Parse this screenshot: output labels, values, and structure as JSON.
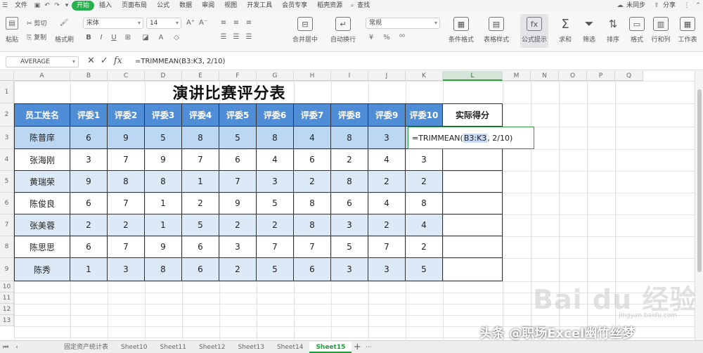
{
  "menu": {
    "file": "文件",
    "items": [
      {
        "label": "开始",
        "active": true
      },
      {
        "label": "插入",
        "active": false
      },
      {
        "label": "页面布局",
        "active": false
      },
      {
        "label": "公式",
        "active": false
      },
      {
        "label": "数据",
        "active": false
      },
      {
        "label": "审阅",
        "active": false
      },
      {
        "label": "视图",
        "active": false
      },
      {
        "label": "开发工具",
        "active": false
      },
      {
        "label": "会员专享",
        "active": false
      },
      {
        "label": "稻壳资源",
        "active": false
      }
    ],
    "search": "查找",
    "collab": "未同步",
    "share": "分享"
  },
  "ribbon": {
    "paste": "粘贴",
    "cut": "剪切",
    "copy": "复制",
    "format_painter": "格式刷",
    "font": "宋体",
    "font_size": "14",
    "merge": "合并居中",
    "wrap": "自动换行",
    "number_format": "常规",
    "cond_format": "条件格式",
    "table_style": "表格样式",
    "formula_hint": "公式提示",
    "sum": "求和",
    "filter": "筛选",
    "sort": "排序",
    "format": "格式",
    "rowcol": "行和列",
    "worksheet": "工作表"
  },
  "formula_bar": {
    "name_box": "AVERAGE",
    "formula": "=TRIMMEAN(B3:K3, 2/10)"
  },
  "grid": {
    "columns": [
      "A",
      "B",
      "C",
      "D",
      "E",
      "F",
      "G",
      "H",
      "I",
      "J",
      "K",
      "L",
      "M",
      "N",
      "O",
      "P",
      "Q"
    ],
    "selected_column": "L",
    "rows": [
      "1",
      "2",
      "3",
      "4",
      "5",
      "6",
      "7",
      "8",
      "9",
      "10",
      "11",
      "12",
      "13"
    ],
    "title": "演讲比赛评分表",
    "headers": [
      "员工姓名",
      "评委1",
      "评委2",
      "评委3",
      "评委4",
      "评委5",
      "评委6",
      "评委7",
      "评委8",
      "评委9",
      "评委10",
      "实际得分"
    ],
    "data": [
      {
        "name": "陈普庠",
        "scores": [
          "6",
          "9",
          "5",
          "8",
          "5",
          "8",
          "4",
          "8",
          "3",
          ""
        ]
      },
      {
        "name": "张海刚",
        "scores": [
          "3",
          "7",
          "9",
          "7",
          "6",
          "4",
          "6",
          "2",
          "4",
          "3"
        ]
      },
      {
        "name": "黄瑞荣",
        "scores": [
          "9",
          "8",
          "8",
          "1",
          "7",
          "3",
          "2",
          "8",
          "2",
          "2"
        ]
      },
      {
        "name": "陈俊良",
        "scores": [
          "6",
          "7",
          "1",
          "2",
          "9",
          "5",
          "8",
          "6",
          "4",
          "8"
        ]
      },
      {
        "name": "张美蓉",
        "scores": [
          "2",
          "2",
          "1",
          "5",
          "2",
          "2",
          "8",
          "3",
          "2",
          "4"
        ]
      },
      {
        "name": "陈思思",
        "scores": [
          "6",
          "7",
          "9",
          "6",
          "3",
          "7",
          "7",
          "5",
          "7",
          "2"
        ]
      },
      {
        "name": "陈秀",
        "scores": [
          "1",
          "3",
          "8",
          "6",
          "2",
          "5",
          "6",
          "3",
          "3",
          "5"
        ]
      }
    ],
    "editing_text_prefix": "=TRIMMEAN(",
    "editing_text_ref": "B3:K3",
    "editing_text_suffix": ", 2/10)"
  },
  "sheets": {
    "tabs": [
      "固定资产统计表",
      "Sheet10",
      "Sheet11",
      "Sheet12",
      "Sheet13",
      "Sheet14",
      "Sheet15"
    ],
    "active": "Sheet15"
  },
  "watermark": {
    "author": "头条 @职场Excel幽竹丝梦",
    "baidu": "Bai du 经验",
    "baidu_sub": "jingyan.baidu.com"
  }
}
